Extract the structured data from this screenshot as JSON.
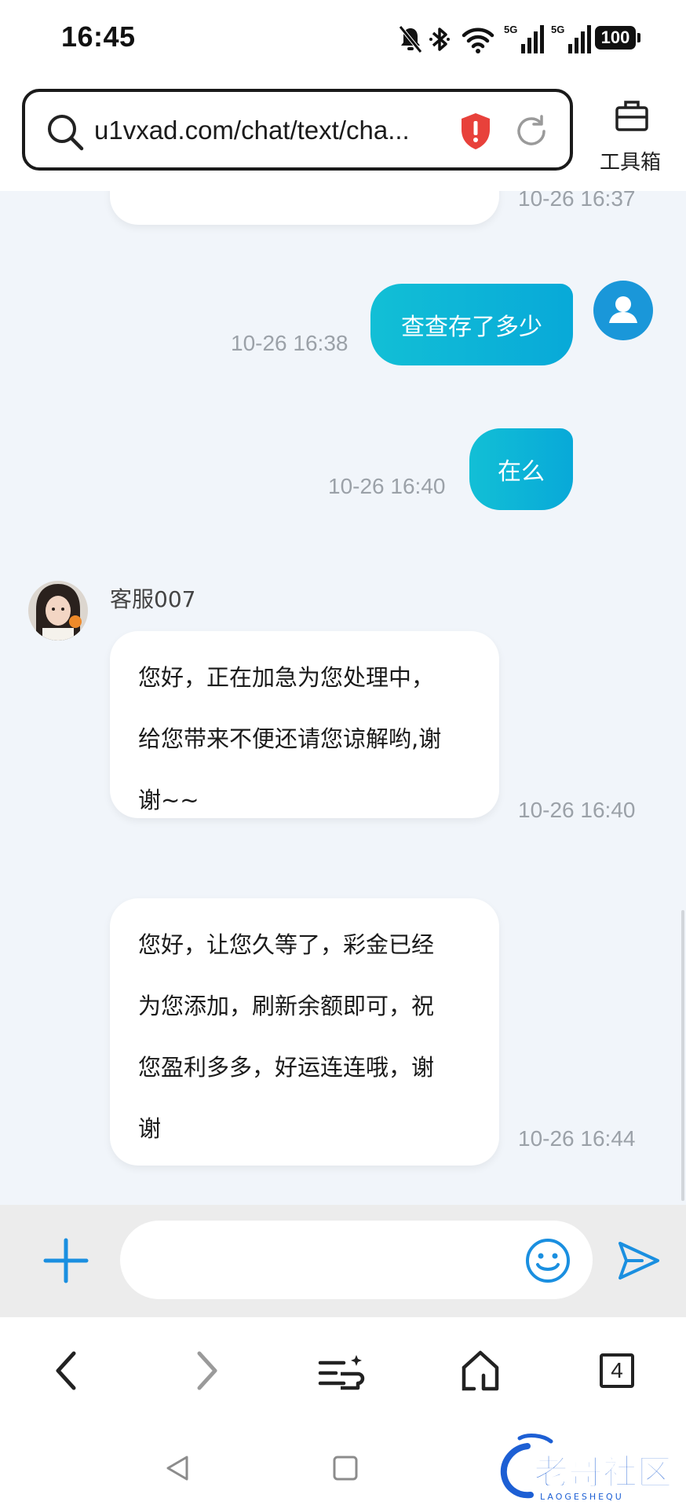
{
  "status_bar": {
    "time": "16:45",
    "battery": "100",
    "icons": [
      "mute-bell-icon",
      "bluetooth-icon",
      "wifi-icon",
      "signal-5g-icon",
      "signal-5g-icon"
    ]
  },
  "browser": {
    "url": "u1vxad.com/chat/text/cha...",
    "toolbox_label": "工具箱",
    "tab_count": "4"
  },
  "chat": {
    "messages": [
      {
        "direction": "incoming",
        "time": "10-26 16:37"
      },
      {
        "direction": "outgoing",
        "text": "查查存了多少",
        "time": "10-26 16:38"
      },
      {
        "direction": "outgoing",
        "text": "在么",
        "time": "10-26 16:40"
      },
      {
        "direction": "incoming",
        "sender": "客服007",
        "lines": [
          "您好，正在加急为您处理中，",
          "给您带来不便还请您谅解哟,谢",
          "谢~~"
        ],
        "time": "10-26 16:40"
      },
      {
        "direction": "incoming",
        "lines": [
          "您好，让您久等了，彩金已经",
          "为您添加，刷新余额即可，祝",
          "您盈利多多，好运连连哦，谢",
          "谢"
        ],
        "time": "10-26 16:44"
      }
    ]
  },
  "input": {
    "placeholder": ""
  },
  "watermark": {
    "text": "老哥社区",
    "sub": "LAOGESHEQU"
  },
  "colors": {
    "accent": "#1a8fe0",
    "bubble_out_start": "#12bfd6",
    "bubble_out_end": "#08a9d8",
    "chat_bg": "#f1f5fa",
    "timestamp": "#9ba1a8",
    "alert_red": "#e8413b"
  }
}
